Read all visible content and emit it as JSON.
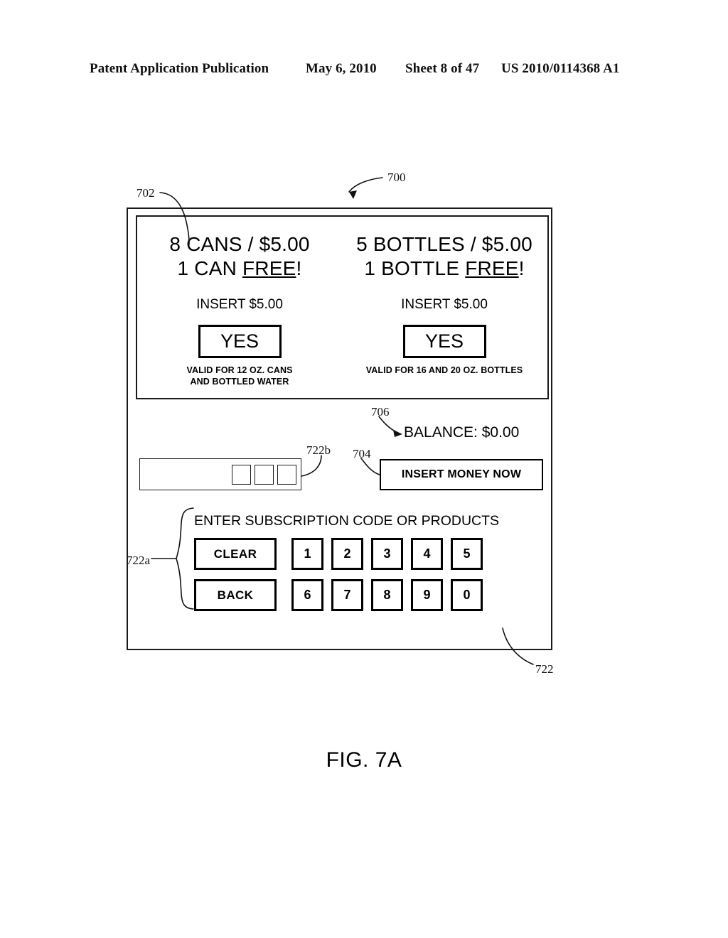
{
  "header": {
    "publication": "Patent Application Publication",
    "date": "May 6, 2010",
    "sheet": "Sheet 8 of 47",
    "number": "US 2010/0114368 A1"
  },
  "figure": {
    "caption": "FIG. 7A"
  },
  "reference_numerals": {
    "machine": "700",
    "promo_panel": "702",
    "insert_money_button": "704",
    "balance": "706",
    "interface_panel": "722",
    "keypad": "722a",
    "code_display": "722b"
  },
  "promo_panel": {
    "offers": [
      {
        "headline": "8 CANS / $5.00",
        "free_prefix": "1 CAN ",
        "free_word": "FREE",
        "free_suffix": "!",
        "insert_instruction": "INSERT $5.00",
        "accept_button": "YES",
        "validity_line1": "VALID FOR 12 OZ. CANS",
        "validity_line2": "AND BOTTLED WATER"
      },
      {
        "headline": "5 BOTTLES / $5.00",
        "free_prefix": "1 BOTTLE ",
        "free_word": "FREE",
        "free_suffix": "!",
        "insert_instruction": "INSERT $5.00",
        "accept_button": "YES",
        "validity_line1": "VALID FOR 16 AND 20 OZ. BOTTLES",
        "validity_line2": ""
      }
    ]
  },
  "interface_panel": {
    "balance_label": "BALANCE: $0.00",
    "insert_money_button": "INSERT MONEY NOW",
    "code_display": {
      "value": "",
      "slot_count": 3
    },
    "keypad": {
      "title": "ENTER SUBSCRIPTION CODE OR PRODUCTS",
      "clear_label": "CLEAR",
      "back_label": "BACK",
      "row1_digits": [
        "1",
        "2",
        "3",
        "4",
        "5"
      ],
      "row2_digits": [
        "6",
        "7",
        "8",
        "9",
        "0"
      ]
    }
  },
  "colors": {
    "ink": "#000000",
    "paper": "#ffffff"
  }
}
